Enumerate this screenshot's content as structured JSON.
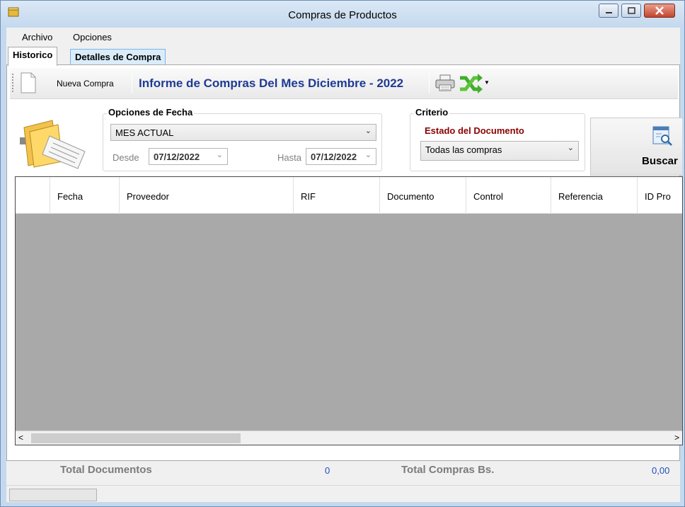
{
  "window": {
    "title": "Compras de Productos"
  },
  "menu": [
    "Archivo",
    "Opciones"
  ],
  "tabs": [
    {
      "label": "Historico",
      "active": true
    },
    {
      "label": "Detalles de Compra",
      "active": false
    }
  ],
  "toolbar": {
    "new_label": "Nueva Compra",
    "report_title": "Informe de Compras Del Mes Diciembre - 2022",
    "icons": [
      "document-icon",
      "printer-icon",
      "shuffle-icon"
    ]
  },
  "date_options": {
    "legend": "Opciones de Fecha",
    "period": "MES ACTUAL",
    "from_label": "Desde",
    "from_value": "07/12/2022",
    "to_label": "Hasta",
    "to_value": "07/12/2022"
  },
  "criteria": {
    "legend": "Criterio",
    "label": "Estado del Documento",
    "value": "Todas las compras"
  },
  "search_button": {
    "label": "Buscar"
  },
  "grid": {
    "columns": [
      "",
      "Fecha",
      "Proveedor",
      "RIF",
      "Documento",
      "Control",
      "Referencia",
      "ID Pro"
    ],
    "rows": []
  },
  "totals": {
    "docs_label": "Total Documentos",
    "docs_value": "0",
    "amount_label": "Total Compras Bs.",
    "amount_value": "0,00"
  },
  "colors": {
    "title_blue": "#1f3a93",
    "criteria_red": "#8b0000",
    "total_blue": "#1f4fbf",
    "grid_empty": "#a9a9a9"
  }
}
